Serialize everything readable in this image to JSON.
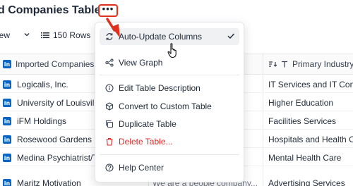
{
  "header": {
    "title": "d Companies Table",
    "more_label": "•••"
  },
  "toolbar": {
    "view_label": "iew",
    "rows_label": "150 Rows"
  },
  "columns": [
    {
      "label": "Imported Companies"
    },
    {
      "label": "Primary Industry"
    }
  ],
  "rows": [
    {
      "company": "Logicalis, Inc.",
      "middle": "",
      "industry": "IT Services and IT Cons"
    },
    {
      "company": "University of Louisvill",
      "middle": "",
      "industry": "Higher Education"
    },
    {
      "company": "iFM Holdings",
      "middle": "",
      "industry": "Facilities Services"
    },
    {
      "company": "Rosewood Gardens R",
      "middle": "",
      "industry": "Hospitals and Health Ca"
    },
    {
      "company": "Medina Psychiatrist/T",
      "middle": "",
      "industry": "Mental Health Care"
    },
    {
      "company": "Maritz Motivation",
      "middle": "We are a people company...",
      "industry": "Advertising Services"
    }
  ],
  "menu": {
    "items": [
      {
        "label": "Auto-Update Columns",
        "icon": "refresh-icon",
        "checked": true
      },
      {
        "label": "View Graph",
        "icon": "graph-icon"
      },
      {
        "label": "Edit Table Description",
        "icon": "info-icon"
      },
      {
        "label": "Convert to Custom Table",
        "icon": "cube-icon"
      },
      {
        "label": "Duplicate Table",
        "icon": "copy-icon"
      },
      {
        "label": "Delete Table...",
        "icon": "trash-icon",
        "danger": true
      },
      {
        "label": "Help Center",
        "icon": "help-icon"
      }
    ]
  },
  "colors": {
    "accent_red": "#e0301e",
    "linkedin_blue": "#0a66c2",
    "danger": "#dc2626"
  }
}
